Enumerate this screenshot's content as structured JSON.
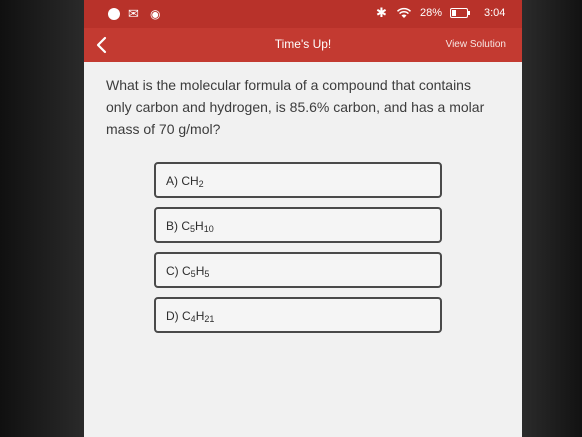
{
  "status_bar": {
    "battery": "28%",
    "time": "3:04",
    "icons": [
      "circle-icon",
      "mail-icon",
      "app-icon",
      "bluetooth-icon",
      "wifi-icon",
      "battery-icon"
    ]
  },
  "app_bar": {
    "back_icon": "chevron-left-icon",
    "title": "Time's Up!",
    "right_action": "View Solution"
  },
  "question": {
    "text": "What is the molecular formula of a compound that contains only carbon and hydrogen, is 85.6% carbon, and has a molar mass of 70 g/mol?"
  },
  "options": {
    "a": {
      "prefix": "A) CH",
      "subscript": "2",
      "tail": "",
      "tail_sub": ""
    },
    "b": {
      "prefix": "B) C",
      "subscript": "5",
      "tail": "H",
      "tail_sub": "10"
    },
    "c": {
      "prefix": "C) C",
      "subscript": "5",
      "tail": "H",
      "tail_sub": "5"
    },
    "d": {
      "prefix": "D) C",
      "subscript": "4",
      "tail": "H",
      "tail_sub": "21"
    }
  },
  "colors": {
    "status_bar": "#b8322a",
    "app_bar": "#c33a31",
    "background": "#f1f1f1",
    "text": "#3c3c3c"
  }
}
